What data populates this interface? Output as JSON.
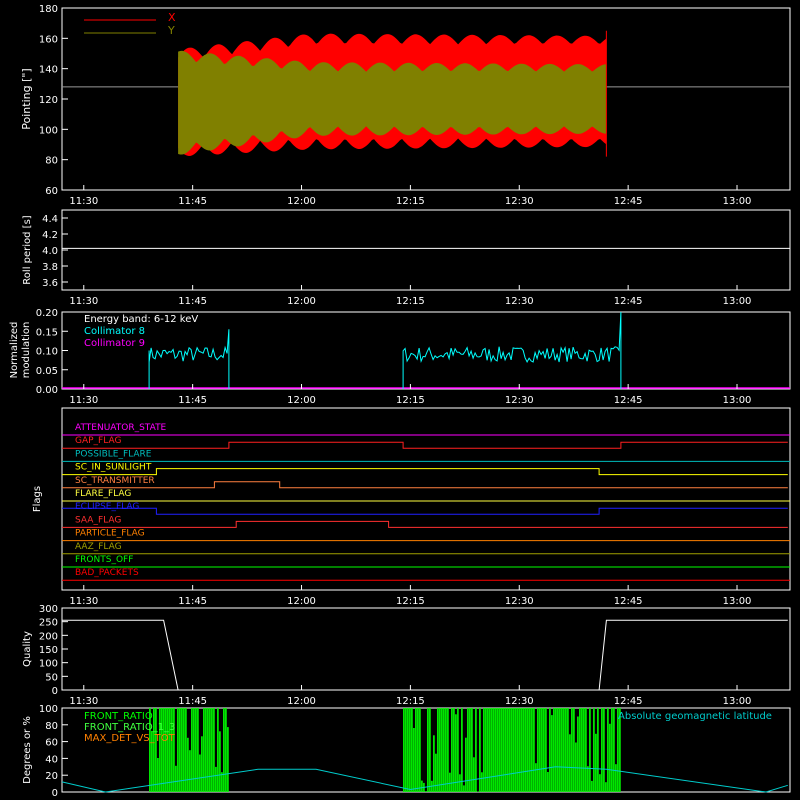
{
  "time_ticks": [
    "11:30",
    "11:45",
    "12:00",
    "12:15",
    "12:30",
    "12:45",
    "13:00"
  ],
  "colors": {
    "background": "#000000",
    "axes": "#ffffff",
    "x_series": "#ff0000",
    "y_series": "#808000",
    "collimator8": "#00ffff",
    "collimator9": "#ff00ff",
    "front_ratio": "#00ff00",
    "latitude": "#00cccc"
  },
  "chart_data": [
    {
      "type": "area",
      "ylabel": "Pointing [\"]",
      "ylim": [
        60,
        180
      ],
      "yticks": [
        "60",
        "80",
        "100",
        "120",
        "140",
        "160",
        "180"
      ],
      "series": [
        {
          "name": "X",
          "color": "#ff0000"
        },
        {
          "name": "Y",
          "color": "#808000"
        }
      ],
      "x_start": "11:43",
      "x_end": "12:42",
      "reference_line": 128,
      "x_envelope_end": {
        "upper": 148,
        "lower": 96
      },
      "y_envelope_end": {
        "upper": 138,
        "lower": 100
      }
    },
    {
      "type": "line",
      "ylabel": "Roll period [s]",
      "ylim": [
        3.5,
        4.5
      ],
      "yticks": [
        "3.6",
        "3.8",
        "4.0",
        "4.2",
        "4.4"
      ],
      "value": 4.02
    },
    {
      "type": "line",
      "ylabel_lines": [
        "Normalized",
        "modulation"
      ],
      "ylim": [
        0,
        0.2
      ],
      "yticks": [
        "0.00",
        "0.05",
        "0.10",
        "0.15",
        "0.20"
      ],
      "annotation": "Energy band: 6-12 keV",
      "series": [
        {
          "name": "Collimator 8",
          "color": "#00ffff",
          "segments": [
            [
              "11:39",
              "11:50"
            ],
            [
              "12:14",
              "12:44"
            ]
          ],
          "mean": 0.09
        },
        {
          "name": "Collimator 9",
          "color": "#ff00ff",
          "value": 0.0
        }
      ]
    },
    {
      "type": "table",
      "ylabel": "Flags",
      "flags": [
        {
          "name": "ATTENUATOR_STATE",
          "color": "#ff00ff"
        },
        {
          "name": "GAP_FLAG",
          "color": "#ff2020"
        },
        {
          "name": "POSSIBLE_FLARE",
          "color": "#00bcbc"
        },
        {
          "name": "SC_IN_SUNLIGHT",
          "color": "#ffff00"
        },
        {
          "name": "SC_TRANSMITTER",
          "color": "#ff8040"
        },
        {
          "name": "FLARE_FLAG",
          "color": "#ffff40"
        },
        {
          "name": "ECLIPSE_FLAG",
          "color": "#2020ff"
        },
        {
          "name": "SAA_FLAG",
          "color": "#ff3030"
        },
        {
          "name": "PARTICLE_FLAG",
          "color": "#ff8000"
        },
        {
          "name": "AAZ_FLAG",
          "color": "#a0a000"
        },
        {
          "name": "FRONTS_OFF",
          "color": "#00ff00"
        },
        {
          "name": "BAD_PACKETS",
          "color": "#ff0000"
        }
      ]
    },
    {
      "type": "line",
      "ylabel": "Quality",
      "ylim": [
        0,
        300
      ],
      "yticks": [
        "0",
        "50",
        "100",
        "150",
        "200",
        "250",
        "300"
      ],
      "points": [
        [
          "11:27",
          255
        ],
        [
          "11:41",
          255
        ],
        [
          "11:43",
          0
        ],
        [
          "12:41",
          0
        ],
        [
          "12:42",
          255
        ],
        [
          "13:07",
          255
        ]
      ]
    },
    {
      "type": "bar",
      "ylabel": "Degrees or %",
      "ylim": [
        0,
        100
      ],
      "yticks": [
        "0",
        "20",
        "40",
        "60",
        "80",
        "100"
      ],
      "series": [
        {
          "name": "FRONT_RATIO",
          "color": "#00ff00",
          "segments": [
            [
              "11:39",
              "11:50"
            ],
            [
              "12:14",
              "12:44"
            ]
          ]
        },
        {
          "name": "FRONT_RATIO_1_3",
          "color": "#40ff40"
        },
        {
          "name": "MAX_DET_VS_TOT",
          "color": "#ff8000"
        }
      ],
      "latitude_label": "Absolute geomagnetic latitude",
      "latitude_points": [
        [
          "11:27",
          12
        ],
        [
          "11:33",
          0
        ],
        [
          "11:54",
          27
        ],
        [
          "12:02",
          27
        ],
        [
          "12:15",
          3
        ],
        [
          "12:35",
          30
        ],
        [
          "12:42",
          27
        ],
        [
          "13:04",
          0
        ],
        [
          "13:07",
          8
        ]
      ]
    }
  ]
}
